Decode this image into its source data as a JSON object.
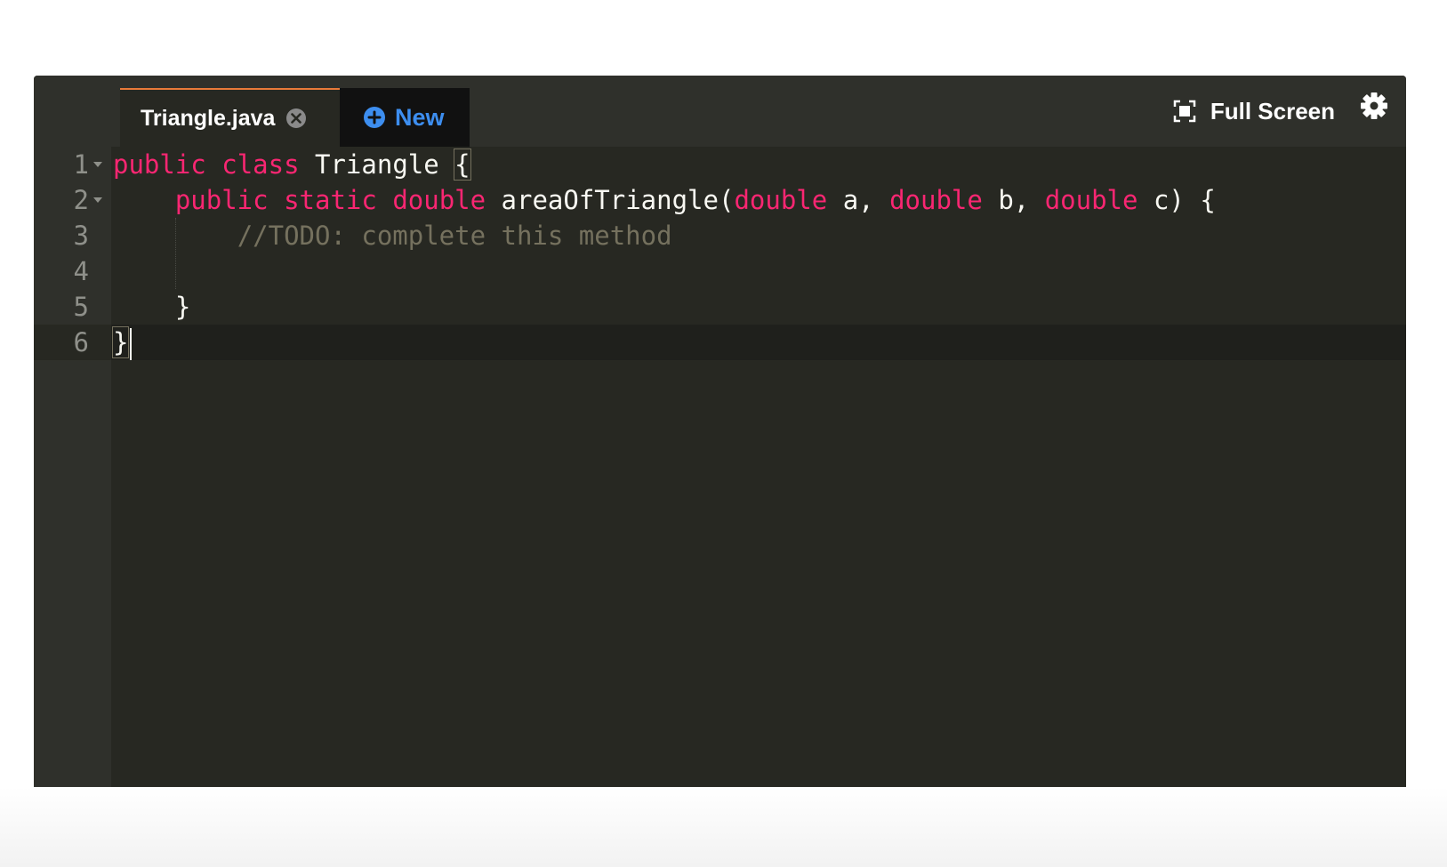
{
  "tabs": {
    "file_name": "Triangle.java",
    "new_label": "New"
  },
  "toolbar": {
    "fullscreen_label": "Full Screen"
  },
  "icons": {
    "close": "close-icon",
    "plus": "plus-icon",
    "fullscreen": "fullscreen-icon",
    "settings": "gear-icon"
  },
  "colors": {
    "keyword": "#f92672",
    "comment": "#75715e",
    "text": "#f8f8f2",
    "tab_accent": "#e8793a",
    "new_button": "#3d8ef0"
  },
  "editor": {
    "line_numbers": [
      "1",
      "2",
      "3",
      "4",
      "5",
      "6"
    ],
    "lines": {
      "l1": {
        "kw1": "public",
        "kw2": "class",
        "name": "Triangle",
        "brace": "{"
      },
      "l2": {
        "kw1": "public",
        "kw2": "static",
        "kw3": "double",
        "method": "areaOfTriangle(",
        "p1type": "double",
        "p1": "a,",
        "p2type": "double",
        "p2": "b,",
        "p3type": "double",
        "p3": "c) {"
      },
      "l3": {
        "comment": "//TODO: complete this method"
      },
      "l5": {
        "brace": "}"
      },
      "l6": {
        "brace": "}"
      }
    }
  }
}
